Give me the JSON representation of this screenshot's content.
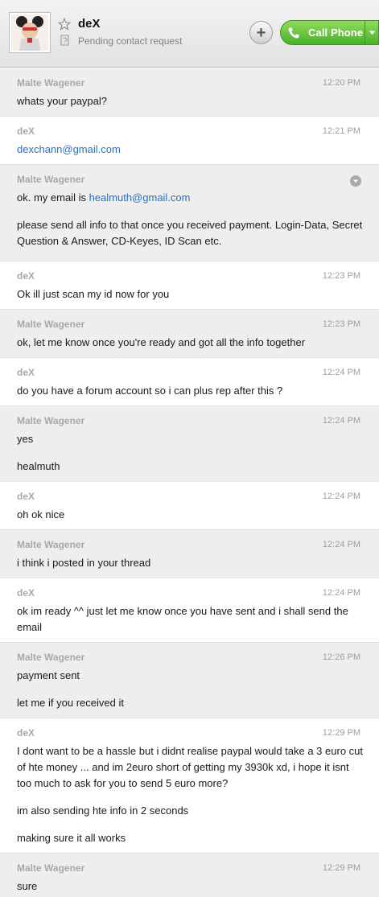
{
  "header": {
    "contact_name": "deX",
    "contact_status": "Pending contact request",
    "call_label": "Call Phone",
    "call_color": "#5cc13a",
    "icons": [
      "avatar",
      "star-icon",
      "pending-icon",
      "add-icon",
      "phone-icon",
      "chevron-down-icon"
    ]
  },
  "messages": [
    {
      "sender": "Malte Wagener",
      "time": "12:20 PM",
      "paragraphs": [
        [
          "whats your paypal?"
        ]
      ]
    },
    {
      "sender": "deX",
      "time": "12:21 PM",
      "paragraphs": [
        [
          {
            "link": "dexchann@gmail.com"
          }
        ]
      ]
    },
    {
      "sender": "Malte Wagener",
      "time": "",
      "paragraphs": [
        [
          "ok. my email is ",
          {
            "link": "healmuth@gmail.com"
          }
        ],
        [
          "please send all info to that once you received payment. Login-Data, Secret Question & Answer, CD-Keyes, ID Scan etc."
        ]
      ]
    },
    {
      "sender": "deX",
      "time": "12:23 PM",
      "paragraphs": [
        [
          "Ok ill just scan my id now for you"
        ]
      ]
    },
    {
      "sender": "Malte Wagener",
      "time": "12:23 PM",
      "paragraphs": [
        [
          "ok, let me know once you're ready and got all the info together"
        ]
      ]
    },
    {
      "sender": "deX",
      "time": "12:24 PM",
      "paragraphs": [
        [
          "do you have a forum account so i can plus rep after this ?"
        ]
      ]
    },
    {
      "sender": "Malte Wagener",
      "time": "12:24 PM",
      "paragraphs": [
        [
          "yes"
        ],
        [
          "healmuth"
        ]
      ]
    },
    {
      "sender": "deX",
      "time": "12:24 PM",
      "paragraphs": [
        [
          "oh ok nice"
        ]
      ]
    },
    {
      "sender": "Malte Wagener",
      "time": "12:24 PM",
      "paragraphs": [
        [
          "i think i posted in your thread"
        ]
      ]
    },
    {
      "sender": "deX",
      "time": "12:24 PM",
      "paragraphs": [
        [
          "ok im ready ^^ just let me know once you have sent and i shall send the email"
        ]
      ]
    },
    {
      "sender": "Malte Wagener",
      "time": "12:26 PM",
      "paragraphs": [
        [
          "payment sent"
        ],
        [
          "let me if you received it"
        ]
      ]
    },
    {
      "sender": "deX",
      "time": "12:29 PM",
      "paragraphs": [
        [
          "I dont want to be a hassle but i didnt realise paypal would take a 3 euro cut of hte money ... and im 2euro short of getting my 3930k xd, i hope it isnt too much to ask for you to send 5 euro more?"
        ],
        [
          "im also sending hte info in 2 seconds"
        ],
        [
          "making sure it all works"
        ]
      ]
    },
    {
      "sender": "Malte Wagener",
      "time": "12:29 PM",
      "paragraphs": [
        [
          "sure"
        ]
      ]
    }
  ]
}
